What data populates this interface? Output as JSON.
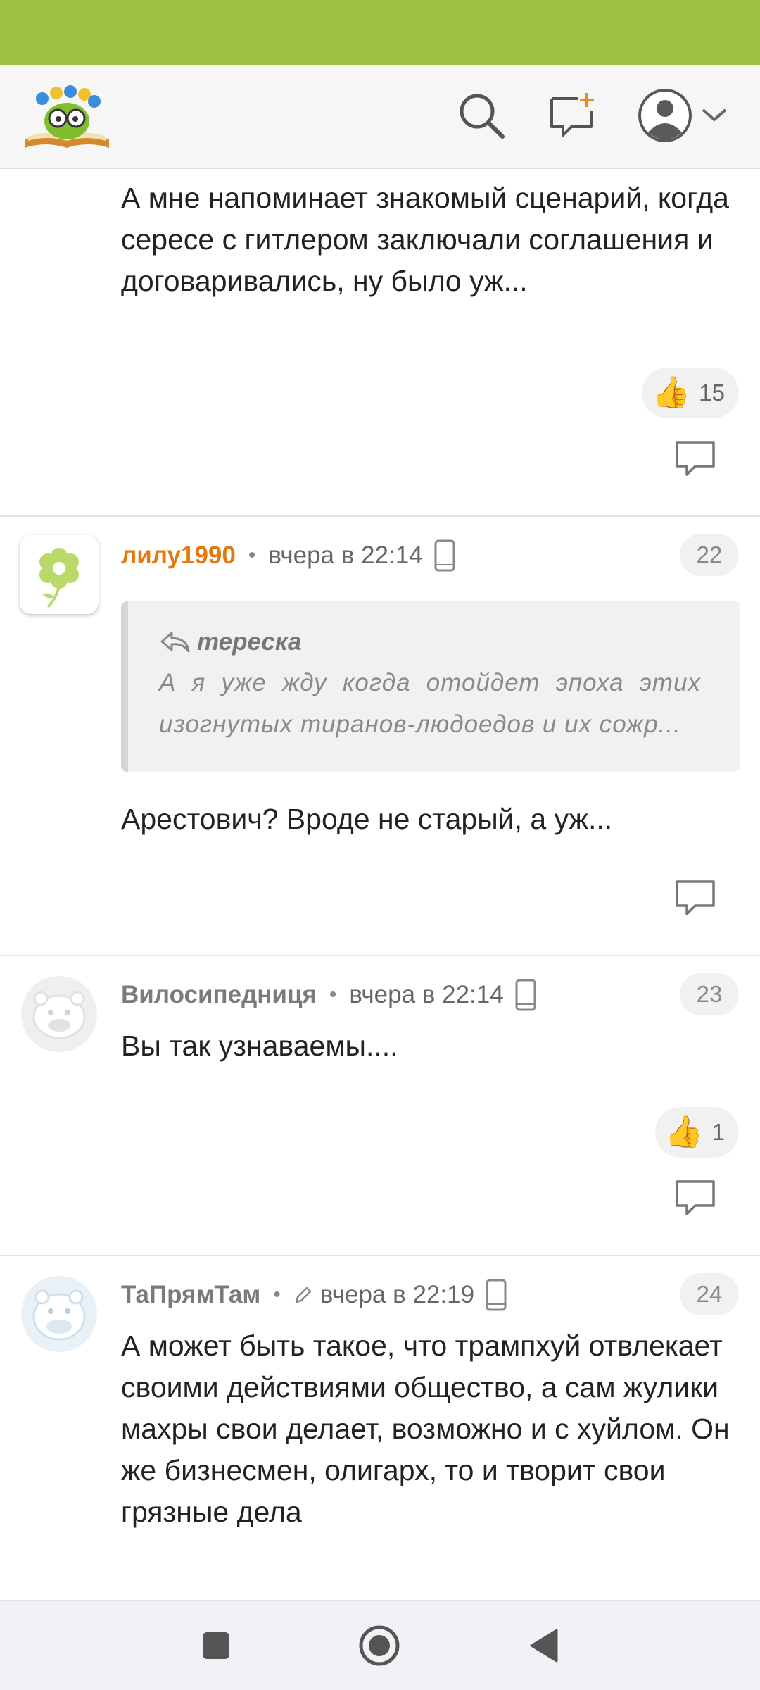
{
  "colors": {
    "status_bar": "#9dc243",
    "accent_orange": "#e37a10"
  },
  "header": {
    "icons": [
      "logo-icon",
      "search-icon",
      "new-message-icon",
      "user-avatar-icon",
      "chevron-down-icon"
    ]
  },
  "comments": [
    {
      "text": "А мне напоминает знакомый сценарий, когда сересе с гитлером заключали соглашения и договаривались, ну было уж...",
      "likes": "15"
    },
    {
      "author": "лилу1990",
      "time": "вчера в 22:14",
      "number": "22",
      "quote_author": "тереска",
      "quote_text": "А я уже жду когда отойдет эпоха этих изогнутых тиранов-людоедов и их сожр...",
      "text": "Арестович? Вроде не старый, а уж..."
    },
    {
      "author": "Вилосипедниця",
      "time": "вчера в 22:14",
      "number": "23",
      "text": "Вы так узнаваемы....",
      "likes": "1"
    },
    {
      "author": "ТаПрямТам",
      "time": "вчера в 22:19",
      "number": "24",
      "text": "А может быть такое, что трампхуй отвлекает своими действиями общество, а сам жулики махры свои делает, возможно и с хуйлом. Он же бизнесмен, олигарх, то и творит свои грязные дела"
    }
  ],
  "navbar": {
    "icons": [
      "recent-apps-icon",
      "home-icon",
      "back-icon"
    ]
  }
}
